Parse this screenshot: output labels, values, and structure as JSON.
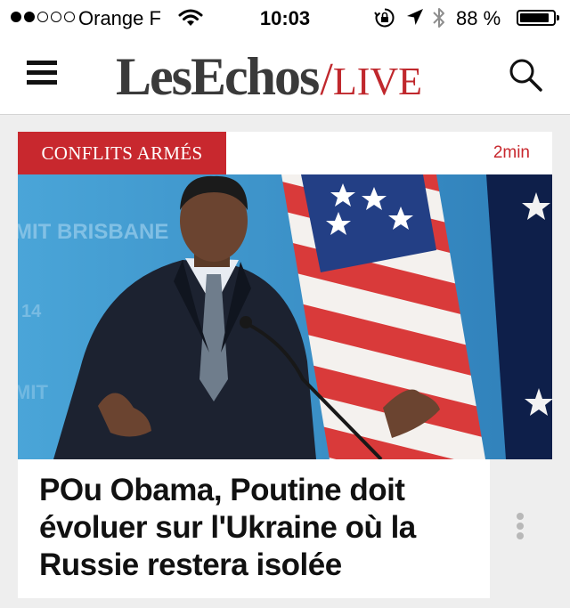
{
  "status_bar": {
    "signal_bars_filled": 2,
    "signal_bars_total": 5,
    "carrier": "Orange F",
    "time": "10:03",
    "battery_text": "88 %",
    "battery_level": 0.88
  },
  "header": {
    "logo_main": "LesEchos",
    "logo_slash": "/",
    "logo_live": "LIVE",
    "menu_icon": "hamburger-menu-icon",
    "search_icon": "search-icon",
    "brand_color": "#c0282d"
  },
  "article": {
    "category": "CONFLITS ARMÉS",
    "read_time": "2min",
    "headline_lines": [
      "POu Obama, Poutine doit",
      "évoluer sur l'Ukraine où la",
      "Russie restera isolée"
    ],
    "photo_backdrop_text": "MIT BRISBANE",
    "more_icon": "vertical-ellipsis-icon",
    "tag_color": "#c8282e"
  }
}
